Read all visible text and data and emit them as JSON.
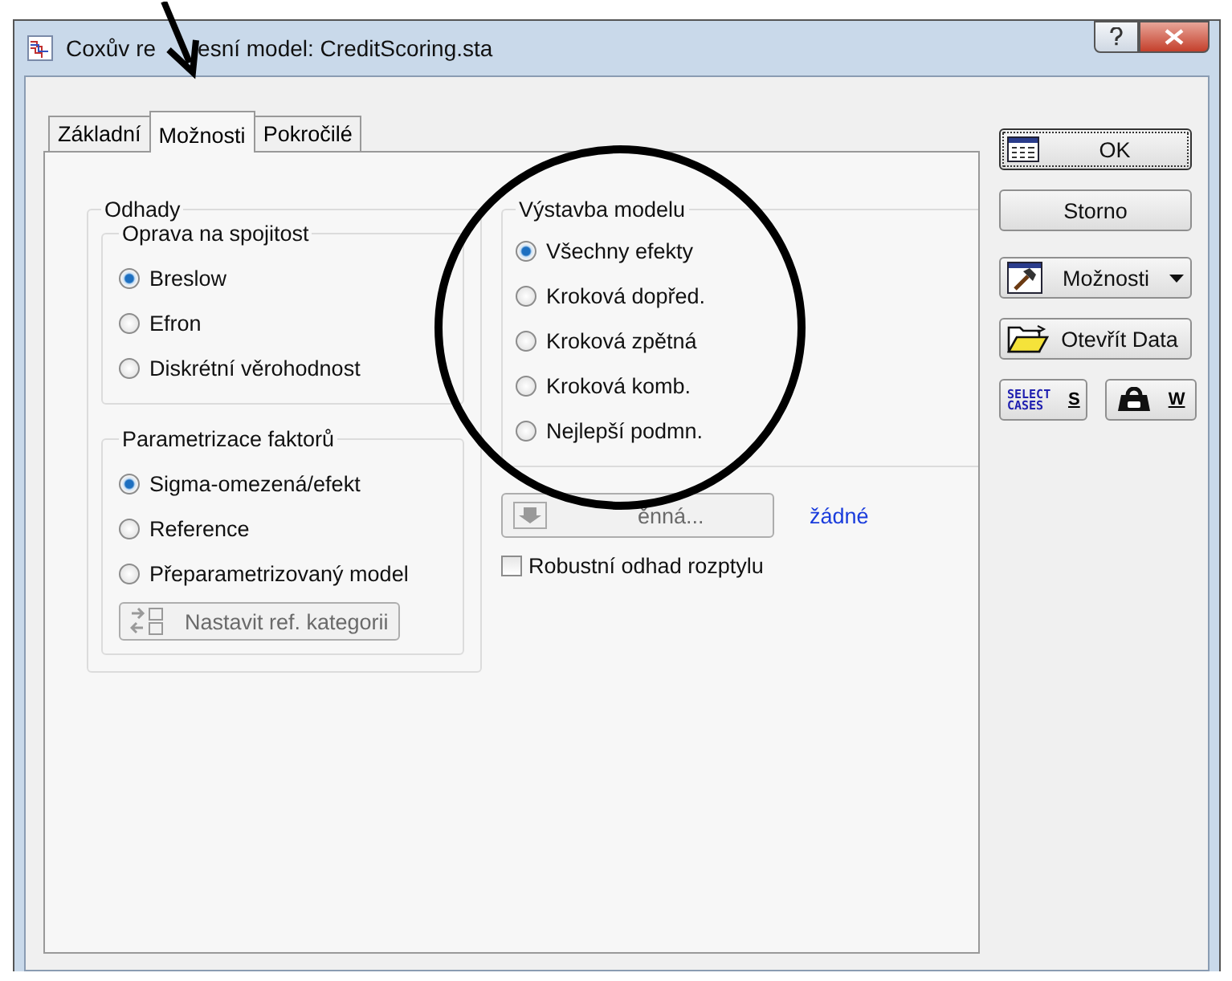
{
  "window": {
    "title_parts": [
      "Coxův re",
      "esní model: CreditScoring.sta"
    ]
  },
  "tabs": [
    {
      "label": "Základní",
      "selected": false
    },
    {
      "label": "Možnosti",
      "selected": true
    },
    {
      "label": "Pokročilé",
      "selected": false
    }
  ],
  "estimates": {
    "title": "Odhady",
    "groups": [
      {
        "title": "Oprava na spojitost",
        "options": [
          {
            "label": "Breslow",
            "selected": true
          },
          {
            "label": "Efron",
            "selected": false
          },
          {
            "label": "Diskrétní věrohodnost",
            "selected": false
          }
        ]
      },
      {
        "title": "Parametrizace faktorů",
        "options": [
          {
            "label": "Sigma-omezená/efekt",
            "selected": true
          },
          {
            "label": "Reference",
            "selected": false
          },
          {
            "label": "Přeparametrizovaný model",
            "selected": false
          }
        ],
        "button": {
          "label": "Nastavit ref. kategorii",
          "disabled": true
        }
      }
    ]
  },
  "model_building": {
    "title": "Výstavba modelu",
    "options": [
      {
        "label": "Všechny efekty",
        "selected": true
      },
      {
        "label": "Kroková dopřed.",
        "selected": false
      },
      {
        "label": "Kroková zpětná",
        "selected": false
      },
      {
        "label": "Kroková komb.",
        "selected": false
      },
      {
        "label": "Nejlepší podmn.",
        "selected": false
      }
    ]
  },
  "variable": {
    "button": "ěnná...",
    "disabled": true,
    "value": "žádné"
  },
  "robust": {
    "label": "Robustní odhad rozptylu",
    "checked": false
  },
  "side_buttons": [
    {
      "kind": "ok",
      "label": "OK"
    },
    {
      "kind": "plain",
      "label": "Storno"
    },
    {
      "kind": "menu",
      "label": "Možnosti"
    },
    {
      "kind": "open",
      "label": "Otevřít Data"
    }
  ],
  "small_buttons": [
    {
      "kind": "select",
      "icon_text": "SELECT CASES",
      "label": "S"
    },
    {
      "kind": "weight",
      "label": "W"
    }
  ]
}
